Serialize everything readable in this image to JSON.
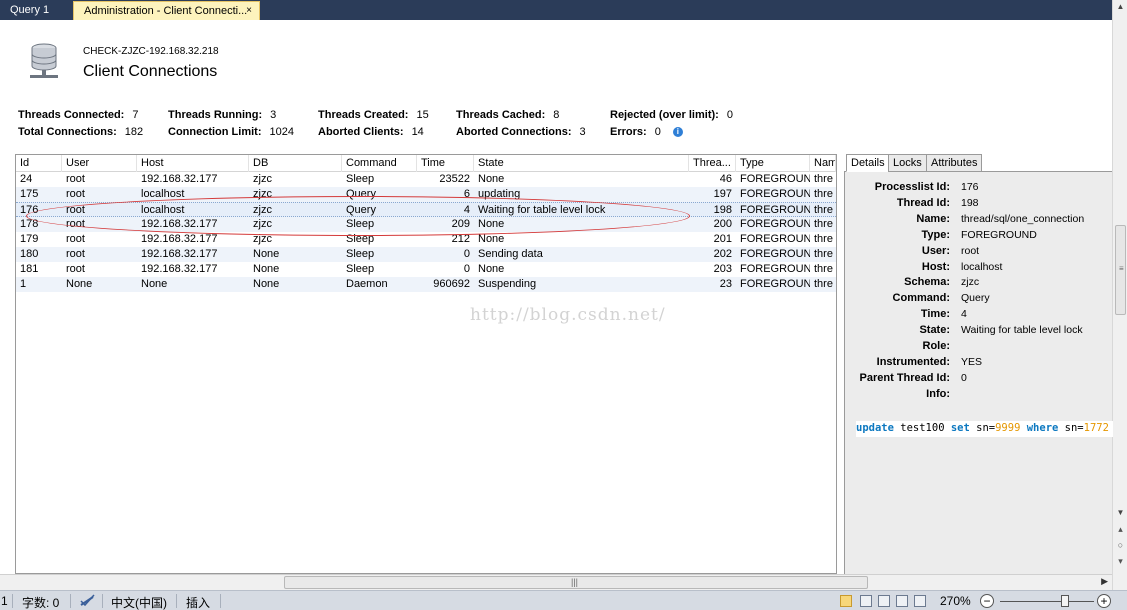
{
  "tabs": [
    {
      "label": "Query 1",
      "active": false
    },
    {
      "label": "Administration - Client Connecti...",
      "active": true
    }
  ],
  "tab_close": "×",
  "header": {
    "server": "CHECK-ZJZC-192.168.32.218",
    "title": "Client Connections"
  },
  "stats": {
    "threads_connected": {
      "label": "Threads Connected:",
      "value": "7"
    },
    "threads_running": {
      "label": "Threads Running:",
      "value": "3"
    },
    "threads_created": {
      "label": "Threads Created:",
      "value": "15"
    },
    "threads_cached": {
      "label": "Threads Cached:",
      "value": "8"
    },
    "rejected": {
      "label": "Rejected (over limit):",
      "value": "0"
    },
    "total_connections": {
      "label": "Total Connections:",
      "value": "182"
    },
    "connection_limit": {
      "label": "Connection Limit:",
      "value": "1024"
    },
    "aborted_clients": {
      "label": "Aborted Clients:",
      "value": "14"
    },
    "aborted_connections": {
      "label": "Aborted Connections:",
      "value": "3"
    },
    "errors": {
      "label": "Errors:",
      "value": "0"
    }
  },
  "grid": {
    "columns": [
      "Id",
      "User",
      "Host",
      "DB",
      "Command",
      "Time",
      "State",
      "Threa...",
      "Type",
      "Name"
    ],
    "rows": [
      [
        "24",
        "root",
        "192.168.32.177",
        "zjzc",
        "Sleep",
        "23522",
        "None",
        "46",
        "FOREGROUND",
        "thre"
      ],
      [
        "175",
        "root",
        "localhost",
        "zjzc",
        "Query",
        "6",
        "updating",
        "197",
        "FOREGROUND",
        "thre"
      ],
      [
        "176",
        "root",
        "localhost",
        "zjzc",
        "Query",
        "4",
        "Waiting for table level lock",
        "198",
        "FOREGROUND",
        "thre"
      ],
      [
        "178",
        "root",
        "192.168.32.177",
        "zjzc",
        "Sleep",
        "209",
        "None",
        "200",
        "FOREGROUND",
        "thre"
      ],
      [
        "179",
        "root",
        "192.168.32.177",
        "zjzc",
        "Sleep",
        "212",
        "None",
        "201",
        "FOREGROUND",
        "thre"
      ],
      [
        "180",
        "root",
        "192.168.32.177",
        "None",
        "Sleep",
        "0",
        "Sending data",
        "202",
        "FOREGROUND",
        "thre"
      ],
      [
        "181",
        "root",
        "192.168.32.177",
        "None",
        "Sleep",
        "0",
        "None",
        "203",
        "FOREGROUND",
        "thre"
      ],
      [
        "1",
        "None",
        "None",
        "None",
        "Daemon",
        "960692",
        "Suspending",
        "23",
        "FOREGROUND",
        "thre"
      ]
    ],
    "selected_row": 2
  },
  "watermark": "http://blog.csdn.net/",
  "details": {
    "tabs": [
      "Details",
      "Locks",
      "Attributes"
    ],
    "active_tab": "Details",
    "fields": [
      {
        "label": "Processlist Id:",
        "value": "176"
      },
      {
        "label": "Thread Id:",
        "value": "198"
      },
      {
        "label": "Name:",
        "value": "thread/sql/one_connection"
      },
      {
        "label": "Type:",
        "value": "FOREGROUND"
      },
      {
        "label": "User:",
        "value": "root"
      },
      {
        "label": "Host:",
        "value": "localhost"
      },
      {
        "label": "Schema:",
        "value": "zjzc"
      },
      {
        "label": "Command:",
        "value": "Query"
      },
      {
        "label": "Time:",
        "value": "4"
      },
      {
        "label": "State:",
        "value": "Waiting for table level lock"
      },
      {
        "label": "Role:",
        "value": ""
      },
      {
        "label": "Instrumented:",
        "value": "YES"
      },
      {
        "label": "Parent Thread Id:",
        "value": "0"
      },
      {
        "label": "Info:",
        "value": ""
      }
    ],
    "sql": {
      "kw1": "update",
      "table": " test100 ",
      "kw2": "set",
      "col1": " sn=",
      "lit1": "9999",
      "kw3": " where",
      "col2": " sn=",
      "lit2": "1772"
    }
  },
  "statusbar": {
    "edge": "1",
    "word_count": "字数: 0",
    "language": "中文(中国)",
    "mode": "插入",
    "zoom": "270%",
    "zoom_minus": "−",
    "zoom_plus": "+"
  },
  "colors": {
    "tabbar": "#2b3c59",
    "active_tab": "#fdf3bd",
    "sql_keyword": "#0c78c0",
    "sql_literal": "#e59700",
    "annotation": "#d43a3a",
    "info_icon": "#2f7fd6"
  }
}
